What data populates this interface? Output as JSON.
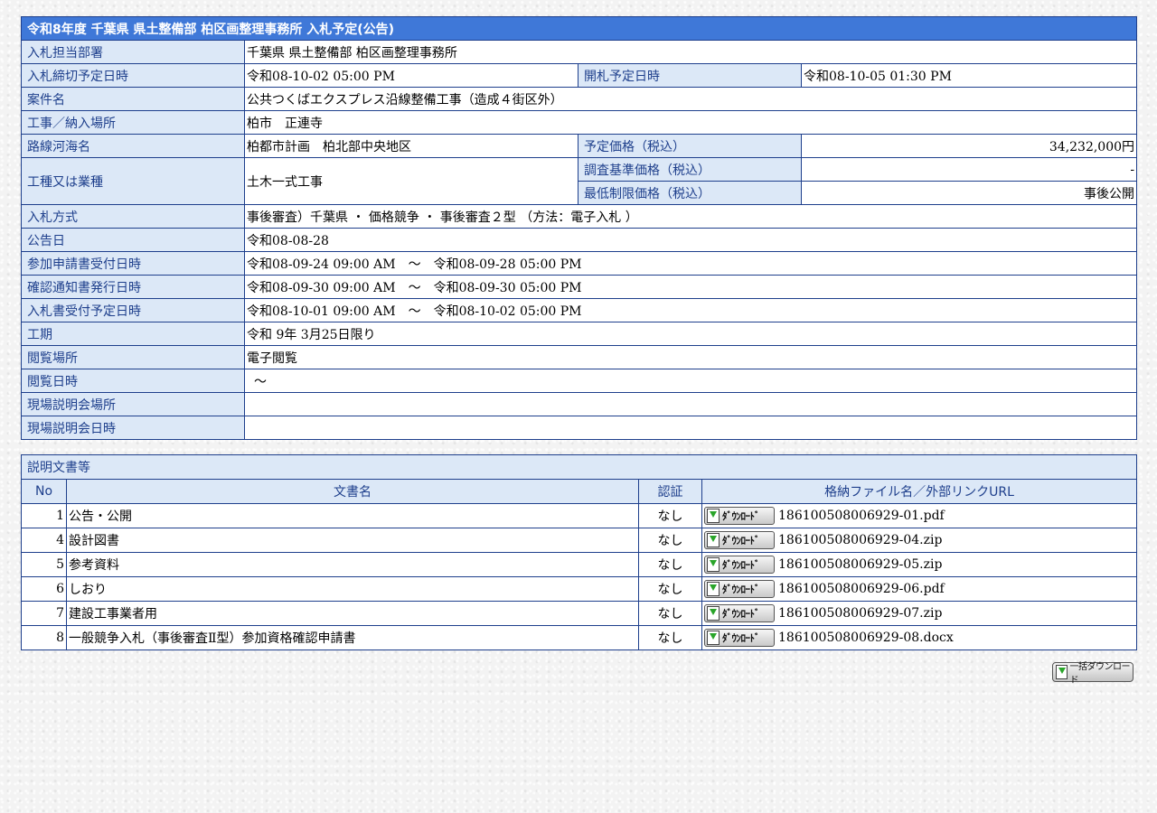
{
  "notice": {
    "title": "令和8年度 千葉県 県土整備部 柏区画整理事務所 入札予定(公告)",
    "rows": {
      "dept_label": "入札担当部署",
      "dept_value": "千葉県 県土整備部 柏区画整理事務所",
      "deadline_label": "入札締切予定日時",
      "deadline_value": "令和08-10-02 05:00 PM",
      "opening_label": "開札予定日時",
      "opening_value": "令和08-10-05 01:30 PM",
      "case_label": "案件名",
      "case_value": "公共つくばエクスプレス沿線整備工事（造成４街区外）",
      "place_label": "工事／納入場所",
      "place_value": "柏市　正連寺",
      "route_label": "路線河海名",
      "route_value": "柏都市計画　柏北部中央地区",
      "est_price_label": "予定価格（税込）",
      "est_price_value": "34,232,000円",
      "type_label": "工種又は業種",
      "type_value": "土木一式工事",
      "survey_price_label": "調査基準価格（税込）",
      "survey_price_value": "-",
      "min_price_label": "最低制限価格（税込）",
      "min_price_value": "事後公開",
      "method_label": "入札方式",
      "method_value": "事後審査）千葉県 ・ 価格競争 ・ 事後審査２型 （方法：電子入札 ）",
      "announce_label": "公告日",
      "announce_value": "令和08-08-28",
      "apply_label": "参加申請書受付日時",
      "apply_value": "令和08-09-24 09:00 AM　～　令和08-09-28 05:00 PM",
      "confirm_label": "確認通知書発行日時",
      "confirm_value": "令和08-09-30 09:00 AM　～　令和08-09-30 05:00 PM",
      "bid_accept_label": "入札書受付予定日時",
      "bid_accept_value": "令和08-10-01 09:00 AM　～　令和08-10-02 05:00 PM",
      "period_label": "工期",
      "period_value": "令和 9年 3月25日限り",
      "view_place_label": "閲覧場所",
      "view_place_value": "電子閲覧",
      "view_date_label": "閲覧日時",
      "view_date_value": "～",
      "site_place_label": "現場説明会場所",
      "site_place_value": "",
      "site_date_label": "現場説明会日時",
      "site_date_value": ""
    }
  },
  "docs": {
    "title": "説明文書等",
    "headers": {
      "no": "No",
      "name": "文書名",
      "cert": "認証",
      "file": "格納ファイル名／外部リンクURL"
    },
    "download_label": "ﾀﾞｳﾝﾛｰﾄﾞ",
    "items": [
      {
        "no": "1",
        "name": "公告・公開",
        "cert": "なし",
        "file": "186100508006929-01.pdf"
      },
      {
        "no": "4",
        "name": "設計図書",
        "cert": "なし",
        "file": "186100508006929-04.zip"
      },
      {
        "no": "5",
        "name": "参考資料",
        "cert": "なし",
        "file": "186100508006929-05.zip"
      },
      {
        "no": "6",
        "name": "しおり",
        "cert": "なし",
        "file": "186100508006929-06.pdf"
      },
      {
        "no": "7",
        "name": "建設工事業者用",
        "cert": "なし",
        "file": "186100508006929-07.zip"
      },
      {
        "no": "8",
        "name": "一般競争入札（事後審査Ⅱ型）参加資格確認申請書",
        "cert": "なし",
        "file": "186100508006929-08.docx"
      }
    ]
  },
  "bulk_download_label": "一括ダウンロード",
  "icons": {
    "download": "download-icon"
  },
  "colors": {
    "header_bg": "#3f78d8",
    "label_bg": "#dce8f7",
    "label_text": "#1e3f8c",
    "border": "#1e3f8c"
  }
}
